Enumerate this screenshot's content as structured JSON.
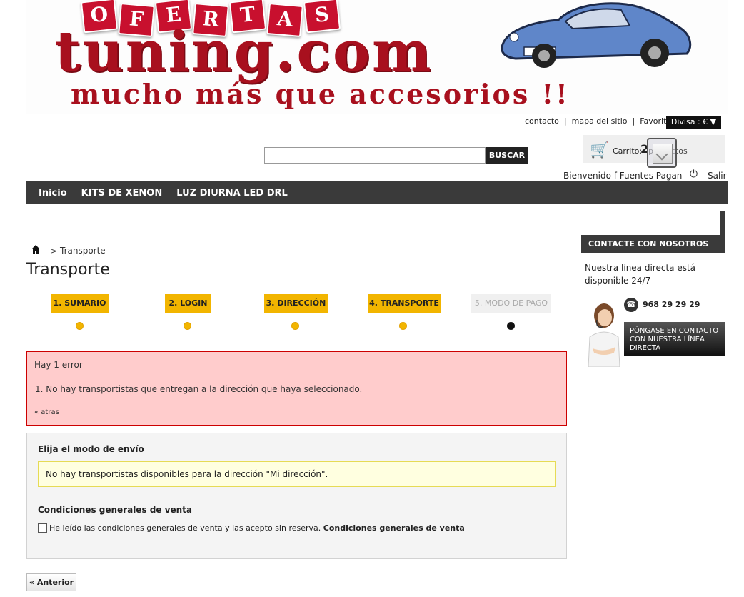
{
  "banner": {
    "tiles": [
      "O",
      "F",
      "E",
      "R",
      "T",
      "A",
      "S"
    ],
    "brand": "tuning.com",
    "slogan": "mucho más que accesorios !!"
  },
  "header": {
    "links": [
      "contacto",
      "mapa del sitio",
      "Favoritos"
    ],
    "currency": "Divisa : € ▼",
    "search": {
      "button": "BUSCAR",
      "value": ""
    },
    "cart": {
      "label": "Carrito:",
      "count": "2",
      "unit": "productos"
    },
    "welcome": "Bienvenido f Fuentes Pagan",
    "logout": "Salir"
  },
  "nav": [
    "Inicio",
    "KITS DE XENON",
    "LUZ DIURNA LED DRL"
  ],
  "breadcrumb": {
    "sep": ">",
    "current": "Transporte"
  },
  "page_title": "Transporte",
  "steps": [
    {
      "label": "1. SUMARIO"
    },
    {
      "label": "2. LOGIN"
    },
    {
      "label": "3. DIRECCIÓN"
    },
    {
      "label": "4. TRANSPORTE"
    },
    {
      "label": "5. MODO DE PAGO"
    }
  ],
  "error": {
    "title": "Hay 1 error",
    "message": "1.  No hay transportistas que entregan a la dirección que haya seleccionado.",
    "back": "« atras"
  },
  "shipping": {
    "title": "Elija el modo de envío",
    "warning": "No hay transportistas disponibles para la dirección \"Mi dirección\".",
    "conditions_title": "Condiciones generales de venta",
    "conditions_text": "He leído las condiciones generales de venta y las acepto sin reserva.",
    "conditions_link": "Condiciones generales de venta"
  },
  "prev_button": "« Anterior",
  "sidebar": {
    "heading": "CONTACTE CON NOSOTROS",
    "text": "Nuestra línea directa está disponible 24/7",
    "phone": "968 29 29 29",
    "contact_button": "PÓNGASE EN CONTACTO CON NUESTRA LÍNEA DIRECTA"
  },
  "colors": {
    "accent": "#f2b500",
    "nav": "#3a3a3a",
    "brand": "#a8101e",
    "error_bg": "#ffcccc"
  }
}
